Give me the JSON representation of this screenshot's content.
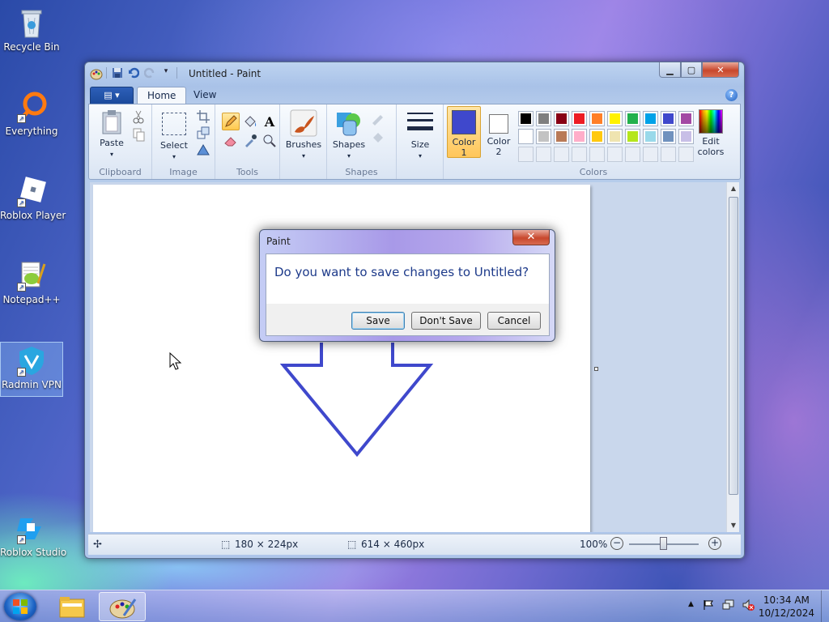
{
  "desktop": {
    "icons": [
      {
        "label": "Recycle Bin"
      },
      {
        "label": "Everything"
      },
      {
        "label": "Roblox Player"
      },
      {
        "label": "Notepad++"
      },
      {
        "label": "Radmin VPN"
      },
      {
        "label": "Roblox Studio"
      }
    ]
  },
  "window": {
    "title": "Untitled - Paint",
    "tabs": [
      "Home",
      "View"
    ],
    "groups": {
      "clipboard": {
        "name": "Clipboard",
        "paste": "Paste"
      },
      "image": {
        "name": "Image",
        "select": "Select"
      },
      "tools": {
        "name": "Tools"
      },
      "brushes": {
        "label": "Brushes"
      },
      "shapes": {
        "name": "Shapes",
        "label": "Shapes"
      },
      "size": {
        "label": "Size"
      },
      "colors": {
        "name": "Colors",
        "color1_line1": "Color",
        "color1_line2": "1",
        "color2_line1": "Color",
        "color2_line2": "2",
        "edit_line1": "Edit",
        "edit_line2": "colors"
      }
    },
    "palette_row1": [
      "#000000",
      "#7f7f7f",
      "#880015",
      "#ed1c24",
      "#ff7f27",
      "#fff200",
      "#22b14c",
      "#00a2e8",
      "#3f48cc",
      "#a349a4"
    ],
    "palette_row2": [
      "#ffffff",
      "#c3c3c3",
      "#b97a57",
      "#ffaec9",
      "#ffc90e",
      "#efe4b0",
      "#b5e61d",
      "#99d9ea",
      "#7092be",
      "#c8bfe7"
    ],
    "color1": "#3f48cc",
    "color2": "#ffffff",
    "status": {
      "selection_size": "180 × 224px",
      "canvas_size": "614 × 460px",
      "zoom": "100%"
    }
  },
  "dialog": {
    "title": "Paint",
    "message": "Do you want to save changes to Untitled?",
    "buttons": {
      "save": "Save",
      "dont_save": "Don't Save",
      "cancel": "Cancel"
    }
  },
  "taskbar": {
    "time": "10:34 AM",
    "date": "10/12/2024"
  }
}
